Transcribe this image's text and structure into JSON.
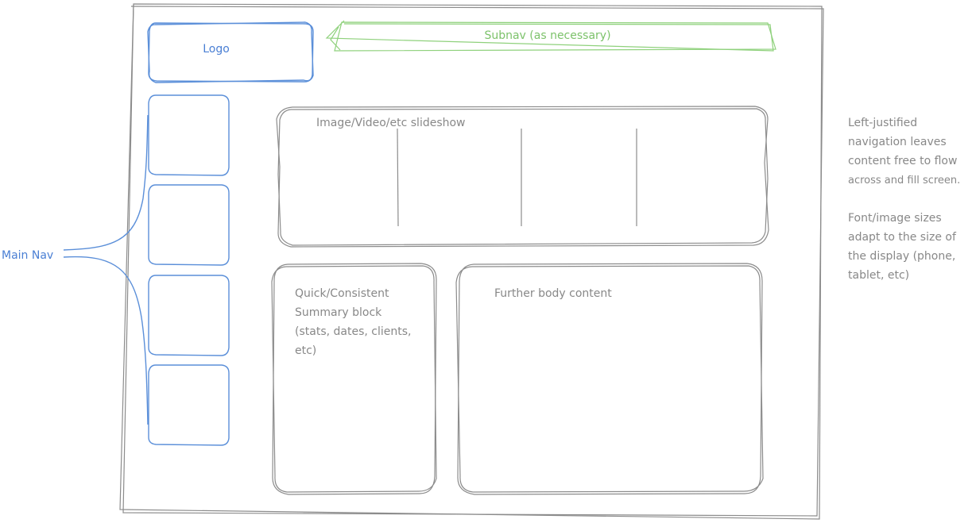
{
  "logo": {
    "label": "Logo"
  },
  "subnav": {
    "label": "Subnav (as necessary)"
  },
  "slideshow": {
    "label": "Image/Video/etc slideshow"
  },
  "summary_block": {
    "lines": [
      "Quick/Consistent",
      "Summary block",
      "(stats, dates, clients,",
      "etc)"
    ]
  },
  "body_content": {
    "label": "Further body content"
  },
  "main_nav": {
    "label": "Main Nav",
    "item_count": 4
  },
  "annotation_1": {
    "lines": [
      "Left-justified",
      "navigation leaves",
      "content free to flow",
      "across and fill screen."
    ]
  },
  "annotation_2": {
    "lines": [
      "Font/image sizes",
      "adapt to the size of",
      "the display (phone,",
      "tablet, etc)"
    ]
  },
  "colors": {
    "sketch_gray": "#8c8c8c",
    "nav_blue": "#5b8fd9",
    "subnav_green": "#8fd17c"
  }
}
